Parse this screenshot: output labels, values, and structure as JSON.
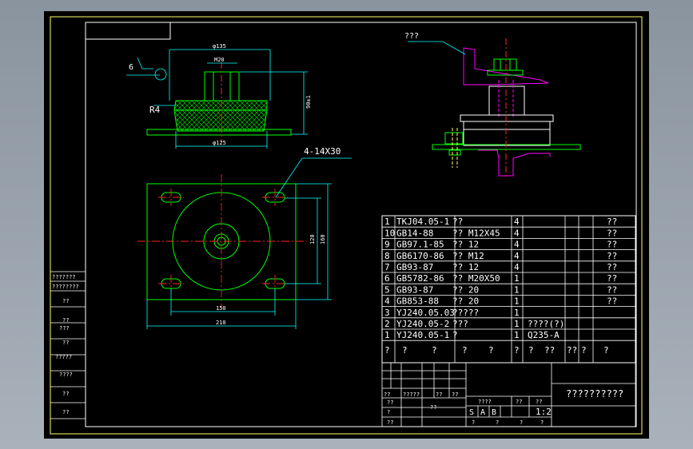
{
  "colors": {
    "background": "#000000",
    "frame": "#ffffff",
    "border_yellow": "#ffff66",
    "outline_green": "#00ff00",
    "dimension_cyan": "#00ffff",
    "centerline_red": "#ff2222",
    "magenta": "#ff00ff",
    "hatch_green": "#00cc00"
  },
  "side_view": {
    "dim_top": "φ135",
    "dim_stud": "M20",
    "dim_bottom": "φ125",
    "dim_height": "90±1",
    "radius_label": "R4",
    "surface_symbol_value": "6"
  },
  "top_view": {
    "hole_label": "4-14X30",
    "dim_inner_height": "120",
    "dim_outer_height": "160",
    "dim_inner_width": "150",
    "dim_outer_width": "210"
  },
  "assembly_view": {
    "callout": "???"
  },
  "bom": {
    "rows": [
      {
        "num": "1",
        "code": "TKJ04.05-1",
        "name": "??",
        "qty": "4",
        "material": "",
        "note": "??"
      },
      {
        "num": "10",
        "code": "GB14-88",
        "name": "??  M12X45",
        "qty": "4",
        "material": "",
        "note": "??"
      },
      {
        "num": "9",
        "code": "GB97.1-85",
        "name": "??  12",
        "qty": "4",
        "material": "",
        "note": "??"
      },
      {
        "num": "8",
        "code": "GB6170-86",
        "name": "??  M12",
        "qty": "4",
        "material": "",
        "note": "??"
      },
      {
        "num": "7",
        "code": "GB93-87",
        "name": "??  12",
        "qty": "4",
        "material": "",
        "note": "??"
      },
      {
        "num": "6",
        "code": "GB5782-86",
        "name": "??  M20X50",
        "qty": "1",
        "material": "",
        "note": "??"
      },
      {
        "num": "5",
        "code": "GB93-87",
        "name": "??  20",
        "qty": "1",
        "material": "",
        "note": "??"
      },
      {
        "num": "4",
        "code": "GB853-88",
        "name": "??  20",
        "qty": "1",
        "material": "",
        "note": "??"
      },
      {
        "num": "3",
        "code": "YJ240.05.03",
        "name": "?????",
        "qty": "1",
        "material": "",
        "note": ""
      },
      {
        "num": "2",
        "code": "YJ240.05-2",
        "name": "???",
        "qty": "1",
        "material": "????(?)",
        "note": ""
      },
      {
        "num": "1",
        "code": "YJ240.05-1",
        "name": "?",
        "qty": "1",
        "material": "Q235-A",
        "note": ""
      }
    ],
    "header": [
      "?",
      "?",
      "?",
      "?",
      "?",
      "?",
      "?",
      "??",
      "??",
      "?",
      "?"
    ]
  },
  "title_block": {
    "title": "??????????",
    "scale": "1:2",
    "scale_label": "??",
    "stage_label": "????",
    "weight_label": "??",
    "stages": [
      "S",
      "A",
      "B"
    ],
    "sign_labels": [
      "??",
      "?????",
      "??",
      "??"
    ],
    "left_labels": [
      "??",
      "??",
      "?",
      "??"
    ],
    "bottom_labels": [
      "?",
      "?",
      "?",
      "?"
    ]
  },
  "side_strip": {
    "labels": [
      "???????",
      "????????",
      "??",
      "??",
      "???",
      "??",
      "?????",
      "????",
      "??",
      "??"
    ]
  }
}
